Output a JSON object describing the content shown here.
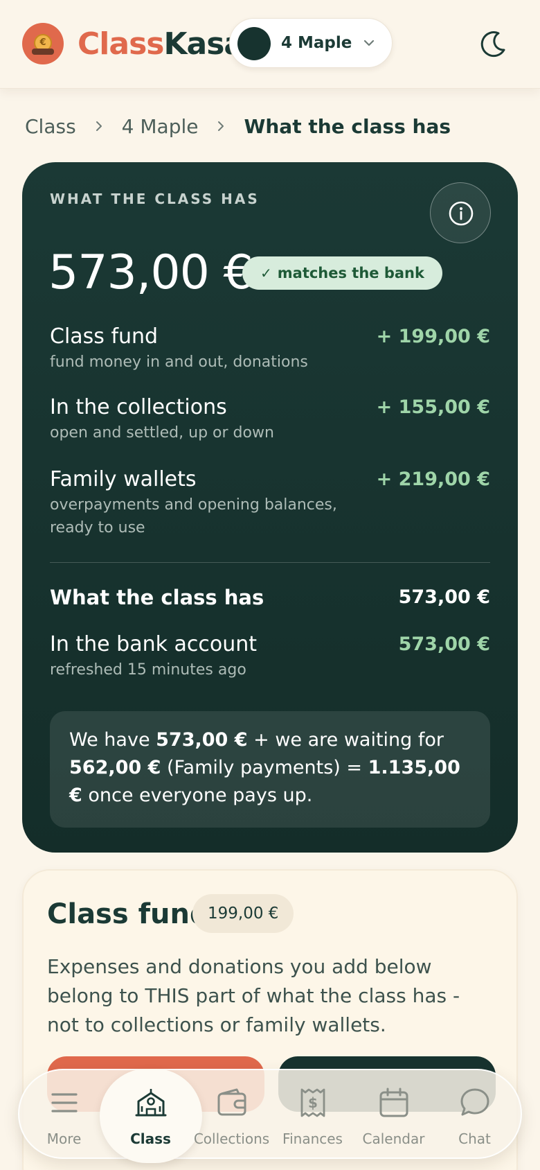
{
  "header": {
    "brand_part1": "Class",
    "brand_part2": "Kasa",
    "class_selector": "4 Maple",
    "icons": [
      "logo-icon",
      "chevron-down-icon",
      "moon-icon"
    ]
  },
  "breadcrumb": {
    "items": [
      "Class",
      "4 Maple"
    ],
    "current": "What the class has"
  },
  "overview": {
    "eyebrow": "WHAT THE CLASS HAS",
    "total": "573,00 €",
    "status_badge": "matches the bank",
    "rows": [
      {
        "label": "Class fund",
        "sub": "fund money in and out, donations",
        "value": "+ 199,00 €"
      },
      {
        "label": "In the collections",
        "sub": "open and settled, up or down",
        "value": "+ 155,00 €"
      },
      {
        "label": "Family wallets",
        "sub": "overpayments and opening balances, ready to use",
        "value": "+ 219,00 €"
      }
    ],
    "summary": {
      "label": "What the class has",
      "value": "573,00 €"
    },
    "bank": {
      "label": "In the bank account",
      "sub": "refreshed 15 minutes ago",
      "value": "573,00 €"
    },
    "note": {
      "t1": "We have ",
      "b1": "573,00 €",
      "t2": " + we are waiting for ",
      "b2": "562,00 €",
      "t3": " (Family payments) = ",
      "b3": "1.135,00 €",
      "t4": " once everyone pays up."
    },
    "colors": {
      "card_bg": "#17332f",
      "positive": "#9fd5a9",
      "badge_bg": "#d7ecdc"
    }
  },
  "class_fund": {
    "title": "Class fund",
    "amount": "199,00 €",
    "description": "Expenses and donations you add below belong to THIS part of what the class has - not to collections or family wallets."
  },
  "bottom_nav": {
    "active": "Class",
    "items": [
      {
        "label": "More",
        "icon": "menu-icon"
      },
      {
        "label": "Class",
        "icon": "school-icon"
      },
      {
        "label": "Collections",
        "icon": "wallet-icon"
      },
      {
        "label": "Finances",
        "icon": "receipt-icon"
      },
      {
        "label": "Calendar",
        "icon": "calendar-icon"
      },
      {
        "label": "Chat",
        "icon": "chat-icon"
      }
    ]
  }
}
